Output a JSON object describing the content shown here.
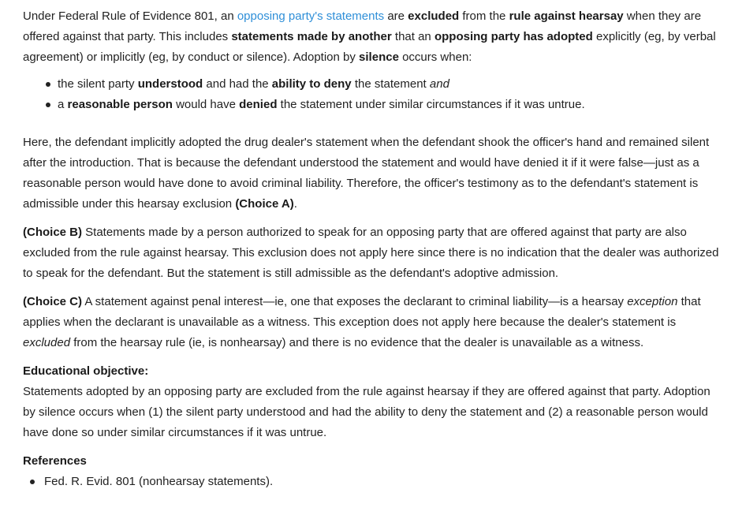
{
  "intro": {
    "t1": "Under Federal Rule of Evidence 801, an ",
    "link": "opposing party's statements",
    "t2": " are ",
    "b1": "excluded",
    "t3": " from the ",
    "b2": "rule against hearsay",
    "t4": " when they are offered against that party.  This includes ",
    "b3": "statements made by another",
    "t5": " that an ",
    "b4": "opposing party has adopted",
    "t6": " explicitly (eg, by verbal agreement) or implicitly (eg, by conduct or silence).  Adoption by ",
    "b5": "silence",
    "t7": " occurs when:"
  },
  "bullets": {
    "one": {
      "t1": "the silent party ",
      "b1": "understood",
      "t2": " and had the ",
      "b2": "ability to deny",
      "t3": " the statement ",
      "i1": "and"
    },
    "two": {
      "t1": "a ",
      "b1": "reasonable person",
      "t2": " would have ",
      "b2": "denied",
      "t3": " the statement under similar circumstances if it was untrue."
    }
  },
  "analysis": {
    "t1": "Here, the defendant implicitly adopted the drug dealer's statement when the defendant shook the officer's hand and remained silent after the introduction.  That is because the defendant understood the statement and would have denied it if it were false—just as a reasonable person would have done to avoid criminal liability.  Therefore, the officer's testimony as to the defendant's statement is admissible under this hearsay exclusion ",
    "b1": "(Choice A)",
    "t2": "."
  },
  "choice_b": {
    "label": "(Choice B)",
    "text": "  Statements made by a person authorized to speak for an opposing party that are offered against that party are also excluded from the rule against hearsay.  This exclusion does not apply here since there is no indication that the dealer was authorized to speak for the defendant.  But the statement is still admissible as the defendant's adoptive admission."
  },
  "choice_c": {
    "label": "(Choice C)",
    "t1": "  A statement against penal interest—ie, one that exposes the declarant to criminal liability—is a hearsay ",
    "i1": "exception",
    "t2": " that applies when the declarant is unavailable as a witness.  This exception does not apply here because the dealer's statement is ",
    "i2": "excluded",
    "t3": " from the hearsay rule (ie, is nonhearsay) and there is no evidence that the dealer is unavailable as a witness."
  },
  "objective": {
    "heading": "Educational objective:",
    "text": "Statements adopted by an opposing party are excluded from the rule against hearsay if they are offered against that party.  Adoption by silence occurs when (1) the silent party understood and had the ability to deny the statement and (2) a reasonable person would have done so under similar circumstances if it was untrue."
  },
  "references": {
    "heading": "References",
    "items": [
      "Fed. R. Evid. 801 (nonhearsay statements)."
    ]
  },
  "colors": {
    "text": "#222222",
    "link": "#2f8fd8"
  }
}
